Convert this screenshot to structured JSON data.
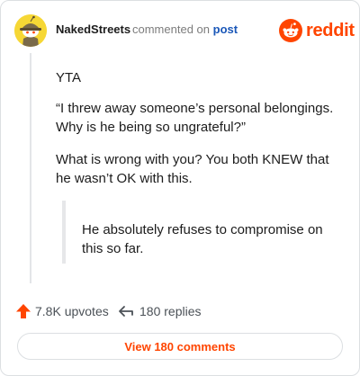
{
  "header": {
    "username": "NakedStreets",
    "verb": "commented on",
    "link": "post",
    "brand": "reddit"
  },
  "comment": {
    "paragraphs": [
      "YTA",
      "“I threw away someone’s personal belongings. Why is he being so ungrateful?”",
      "What is wrong with you? You both KNEW that he wasn’t OK with this."
    ],
    "quote": "He absolutely refuses to compromise on this so far."
  },
  "stats": {
    "upvotes": "7.8K upvotes",
    "replies": "180 replies"
  },
  "footer": {
    "view_label": "View 180 comments"
  },
  "colors": {
    "brand": "#ff4500",
    "link": "#1a57b8",
    "avatar_bg": "#f6d735"
  },
  "icons": [
    "snoo-avatar-icon",
    "reddit-logo-icon",
    "upvote-arrow-icon",
    "reply-arrow-icon"
  ]
}
